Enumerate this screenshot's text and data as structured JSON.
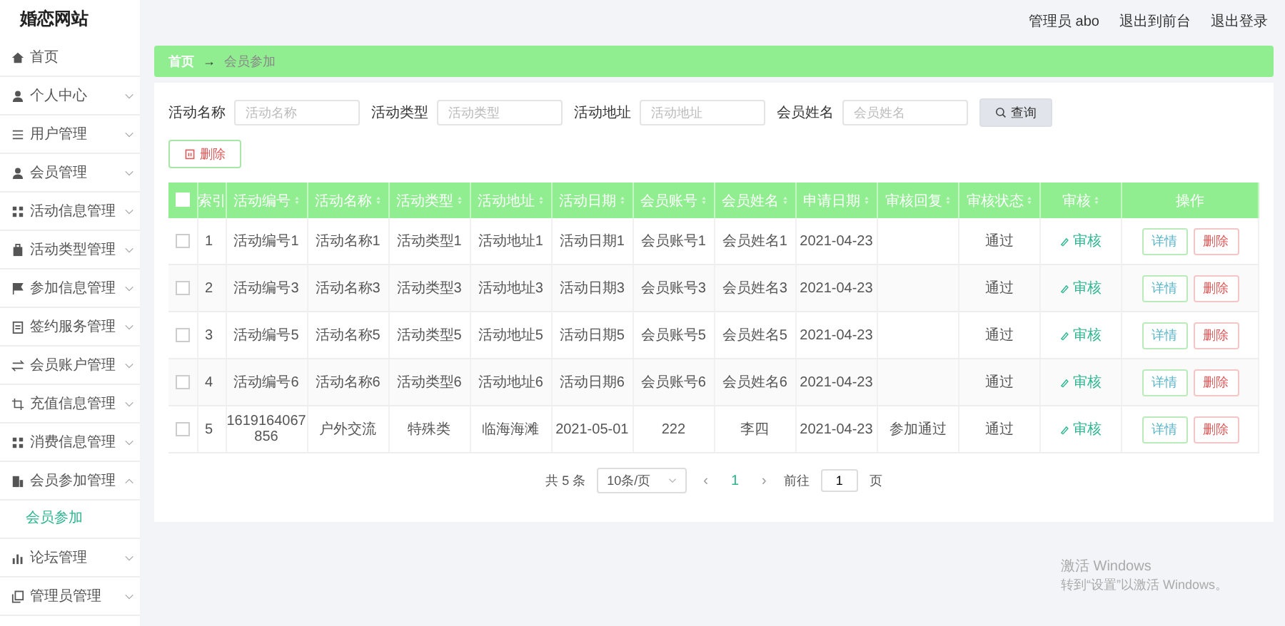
{
  "site_title": "婚恋网站",
  "sidebar": {
    "items": [
      {
        "label": "首页",
        "has_arrow": false
      },
      {
        "label": "个人中心",
        "expanded": false,
        "has_arrow": true
      },
      {
        "label": "用户管理",
        "expanded": false,
        "has_arrow": true
      },
      {
        "label": "会员管理",
        "expanded": false,
        "has_arrow": true
      },
      {
        "label": "活动信息管理",
        "expanded": false,
        "has_arrow": true
      },
      {
        "label": "活动类型管理",
        "expanded": false,
        "has_arrow": true
      },
      {
        "label": "参加信息管理",
        "expanded": false,
        "has_arrow": true
      },
      {
        "label": "签约服务管理",
        "expanded": false,
        "has_arrow": true
      },
      {
        "label": "会员账户管理",
        "expanded": false,
        "has_arrow": true
      },
      {
        "label": "充值信息管理",
        "expanded": false,
        "has_arrow": true
      },
      {
        "label": "消费信息管理",
        "expanded": false,
        "has_arrow": true
      },
      {
        "label": "会员参加管理",
        "expanded": true,
        "has_arrow": true,
        "children": [
          {
            "label": "会员参加",
            "selected": true
          }
        ]
      },
      {
        "label": "论坛管理",
        "expanded": false,
        "has_arrow": true
      },
      {
        "label": "管理员管理",
        "expanded": false,
        "has_arrow": true
      }
    ]
  },
  "header": {
    "user": "管理员 abo",
    "links": [
      "退出到前台",
      "退出登录"
    ]
  },
  "breadcrumb": {
    "home": "首页",
    "separator": "→",
    "current": "会员参加"
  },
  "search": {
    "fields": [
      {
        "label": "活动名称",
        "placeholder": "活动名称"
      },
      {
        "label": "活动类型",
        "placeholder": "活动类型"
      },
      {
        "label": "活动地址",
        "placeholder": "活动地址"
      },
      {
        "label": "会员姓名",
        "placeholder": "会员姓名"
      }
    ],
    "button": "查询"
  },
  "delete_button": "删除",
  "table": {
    "all_checked": false,
    "columns": [
      "索引",
      "活动编号",
      "活动名称",
      "活动类型",
      "活动地址",
      "活动日期",
      "会员账号",
      "会员姓名",
      "申请日期",
      "审核回复",
      "审核状态",
      "审核",
      "操作"
    ],
    "rows": [
      {
        "checked": false,
        "cells": [
          "1",
          "活动编号1",
          "活动名称1",
          "活动类型1",
          "活动地址1",
          "活动日期1",
          "会员账号1",
          "会员姓名1",
          "2021-04-23",
          "",
          "通过"
        ],
        "audit": "审核",
        "actions": [
          "详情",
          "删除"
        ]
      },
      {
        "checked": false,
        "cells": [
          "2",
          "活动编号3",
          "活动名称3",
          "活动类型3",
          "活动地址3",
          "活动日期3",
          "会员账号3",
          "会员姓名3",
          "2021-04-23",
          "",
          "通过"
        ],
        "audit": "审核",
        "actions": [
          "详情",
          "删除"
        ]
      },
      {
        "checked": false,
        "cells": [
          "3",
          "活动编号5",
          "活动名称5",
          "活动类型5",
          "活动地址5",
          "活动日期5",
          "会员账号5",
          "会员姓名5",
          "2021-04-23",
          "",
          "通过"
        ],
        "audit": "审核",
        "actions": [
          "详情",
          "删除"
        ]
      },
      {
        "checked": false,
        "cells": [
          "4",
          "活动编号6",
          "活动名称6",
          "活动类型6",
          "活动地址6",
          "活动日期6",
          "会员账号6",
          "会员姓名6",
          "2021-04-23",
          "",
          "通过"
        ],
        "audit": "审核",
        "actions": [
          "详情",
          "删除"
        ]
      },
      {
        "checked": false,
        "cells": [
          "5",
          "1619164067856",
          "户外交流",
          "特殊类",
          "临海海滩",
          "2021-05-01",
          "222",
          "李四",
          "2021-04-23",
          "参加通过",
          "通过"
        ],
        "audit": "审核",
        "actions": [
          "详情",
          "删除"
        ]
      }
    ]
  },
  "pagination": {
    "total": "共 5 条",
    "page_size": "10条/页",
    "prev": "‹",
    "pages": [
      {
        "label": "1",
        "selected": true
      }
    ],
    "next": "›",
    "goto_label": "前往",
    "goto_value": "1",
    "goto_suffix": "页"
  },
  "os_notice": {
    "title": "激活 Windows",
    "text": "转到“设置”以激活 Windows。"
  }
}
